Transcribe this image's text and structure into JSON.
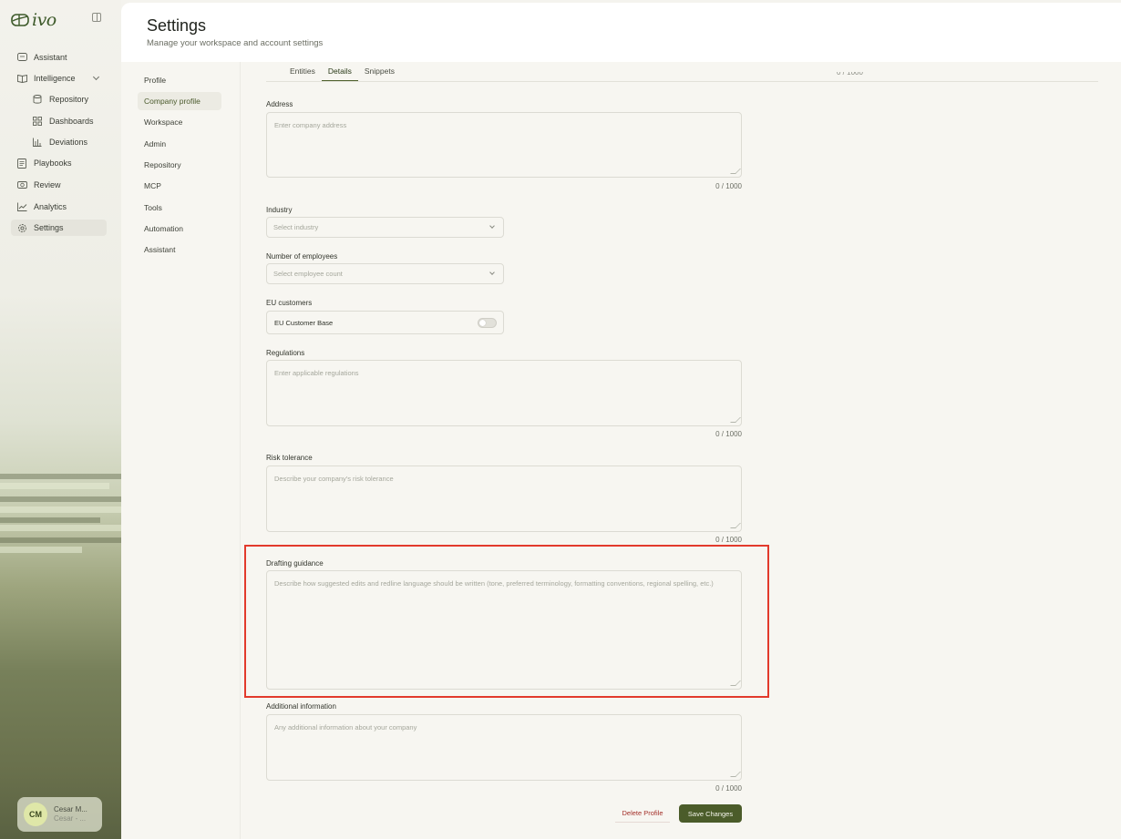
{
  "app": {
    "logo_text": "ivo"
  },
  "sidebar": {
    "items": [
      {
        "label": "Assistant",
        "icon": "chat-icon"
      },
      {
        "label": "Intelligence",
        "icon": "book-icon"
      },
      {
        "label": "Repository",
        "icon": "database-icon"
      },
      {
        "label": "Dashboards",
        "icon": "grid-icon"
      },
      {
        "label": "Deviations",
        "icon": "bar-chart-icon"
      },
      {
        "label": "Playbooks",
        "icon": "document-icon"
      },
      {
        "label": "Review",
        "icon": "review-icon"
      },
      {
        "label": "Analytics",
        "icon": "line-chart-icon"
      },
      {
        "label": "Settings",
        "icon": "gear-icon"
      }
    ],
    "active": "Settings",
    "user": {
      "initials": "CM",
      "name": "Cesar M...",
      "sub": "Cesar - ..."
    }
  },
  "header": {
    "title": "Settings",
    "subtitle": "Manage your workspace and account settings"
  },
  "settings_nav": {
    "items": [
      "Profile",
      "Company profile",
      "Workspace",
      "Admin",
      "Repository",
      "MCP",
      "Tools",
      "Automation",
      "Assistant"
    ],
    "active": "Company profile"
  },
  "tabs": {
    "items": [
      "Entities",
      "Details",
      "Snippets"
    ],
    "active": "Details"
  },
  "form": {
    "prev_counter": "0 / 1000",
    "address": {
      "label": "Address",
      "placeholder": "Enter company address",
      "counter": "0 / 1000"
    },
    "industry": {
      "label": "Industry",
      "placeholder": "Select industry"
    },
    "employees": {
      "label": "Number of employees",
      "placeholder": "Select employee count"
    },
    "eu": {
      "label": "EU customers",
      "toggle_label": "EU Customer Base",
      "enabled": false
    },
    "regulations": {
      "label": "Regulations",
      "placeholder": "Enter applicable regulations",
      "counter": "0 / 1000"
    },
    "risk": {
      "label": "Risk tolerance",
      "placeholder": "Describe your company's risk tolerance",
      "counter": "0 / 1000"
    },
    "drafting": {
      "label": "Drafting guidance",
      "placeholder": "Describe how suggested edits and redline language should be written (tone, preferred terminology, formatting conventions, regional spelling, etc.)"
    },
    "additional": {
      "label": "Additional information",
      "placeholder": "Any additional information about your company",
      "counter": "0 / 1000"
    }
  },
  "actions": {
    "delete_label": "Delete Profile",
    "save_label": "Save Changes"
  },
  "colors": {
    "accent": "#4b5c2a",
    "highlight": "#e23a2c",
    "danger": "#a4312a"
  }
}
